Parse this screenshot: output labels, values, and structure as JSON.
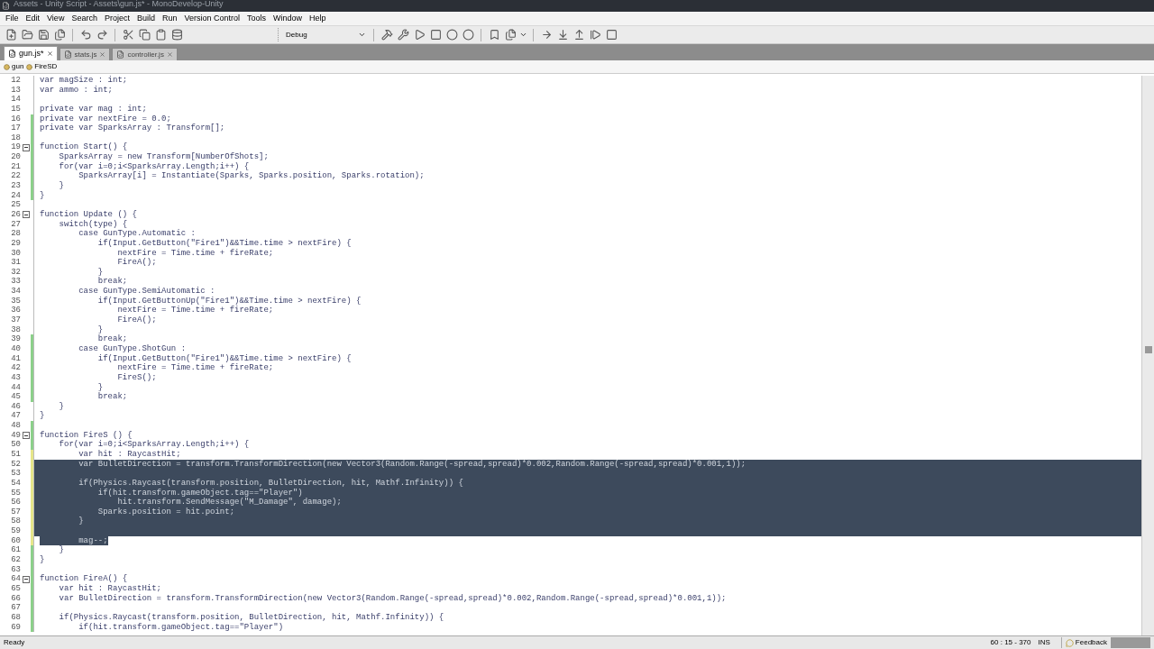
{
  "window": {
    "title": "Assets - Unity Script - Assets\\gun.js* - MonoDevelop-Unity"
  },
  "menu": [
    "File",
    "Edit",
    "View",
    "Search",
    "Project",
    "Build",
    "Run",
    "Version Control",
    "Tools",
    "Window",
    "Help"
  ],
  "toolbar": {
    "configuration": "Debug"
  },
  "tabs": [
    {
      "label": "gun.js*",
      "selected": true
    },
    {
      "label": "stats.js",
      "selected": false
    },
    {
      "label": "controller.js",
      "selected": false
    }
  ],
  "breadcrumb": [
    "gun",
    "FireSD"
  ],
  "lines": [
    {
      "number": "12",
      "text": "var magSize : int;",
      "selected": false
    },
    {
      "number": "13",
      "text": "var ammo : int;",
      "selected": false
    },
    {
      "number": "14",
      "selected": false
    },
    {
      "number": "15",
      "text": "private var mag : int;",
      "selected": false
    },
    {
      "number": "16",
      "text": "private var nextFire = 0.0;",
      "selected": false,
      "color": "#8cd08a"
    },
    {
      "number": "17",
      "text": "private var SparksArray : Transform[];",
      "selected": false,
      "color": "#8cd08a"
    },
    {
      "number": "18",
      "selected": false,
      "color": "#8cd08a"
    },
    {
      "number": "19",
      "text": "function Start() {",
      "selected": false,
      "color": "#8cd08a",
      "fold": true
    },
    {
      "number": "20",
      "text": "    SparksArray = new Transform[NumberOfShots];",
      "selected": false,
      "color": "#8cd08a"
    },
    {
      "number": "21",
      "text": "    for(var i=0;i<SparksArray.Length;i++) {",
      "selected": false,
      "color": "#8cd08a"
    },
    {
      "number": "22",
      "text": "        SparksArray[i] = Instantiate(Sparks, Sparks.position, Sparks.rotation);",
      "selected": false,
      "color": "#8cd08a"
    },
    {
      "number": "23",
      "text": "    }",
      "selected": false,
      "color": "#8cd08a"
    },
    {
      "number": "24",
      "text": "}",
      "selected": false,
      "color": "#8cd08a"
    },
    {
      "number": "25",
      "selected": false
    },
    {
      "number": "26",
      "text": "function Update () {",
      "selected": false,
      "fold": true
    },
    {
      "number": "27",
      "text": "    switch(type) {",
      "selected": false
    },
    {
      "number": "28",
      "text": "        case GunType.Automatic :",
      "selected": false
    },
    {
      "number": "29",
      "text": "            if(Input.GetButton(\"Fire1\")&&Time.time > nextFire) {",
      "selected": false
    },
    {
      "number": "30",
      "text": "                nextFire = Time.time + fireRate;",
      "selected": false
    },
    {
      "number": "31",
      "text": "                FireA();",
      "selected": false
    },
    {
      "number": "32",
      "text": "            }",
      "selected": false
    },
    {
      "number": "33",
      "text": "            break;",
      "selected": false
    },
    {
      "number": "34",
      "text": "        case GunType.SemiAutomatic :",
      "selected": false
    },
    {
      "number": "35",
      "text": "            if(Input.GetButtonUp(\"Fire1\")&&Time.time > nextFire) {",
      "selected": false
    },
    {
      "number": "36",
      "text": "                nextFire = Time.time + fireRate;",
      "selected": false
    },
    {
      "number": "37",
      "text": "                FireA();",
      "selected": false
    },
    {
      "number": "38",
      "text": "            }",
      "selected": false
    },
    {
      "number": "39",
      "text": "            break;",
      "selected": false,
      "color": "#8cd08a"
    },
    {
      "number": "40",
      "text": "        case GunType.ShotGun :",
      "selected": false,
      "color": "#8cd08a"
    },
    {
      "number": "41",
      "text": "            if(Input.GetButton(\"Fire1\")&&Time.time > nextFire) {",
      "selected": false,
      "color": "#8cd08a"
    },
    {
      "number": "42",
      "text": "                nextFire = Time.time + fireRate;",
      "selected": false,
      "color": "#8cd08a"
    },
    {
      "number": "43",
      "text": "                FireS();",
      "selected": false,
      "color": "#8cd08a"
    },
    {
      "number": "44",
      "text": "            }",
      "selected": false,
      "color": "#8cd08a"
    },
    {
      "number": "45",
      "text": "            break;",
      "selected": false,
      "color": "#8cd08a"
    },
    {
      "number": "46",
      "text": "    }",
      "selected": false
    },
    {
      "number": "47",
      "text": "}",
      "selected": false
    },
    {
      "number": "48",
      "selected": false,
      "color": "#8cd08a"
    },
    {
      "number": "49",
      "text": "function FireS () {",
      "selected": false,
      "color": "#8cd08a",
      "fold": true
    },
    {
      "number": "50",
      "text": "    for(var i=0;i<SparksArray.Length;i++) {",
      "selected": false,
      "color": "#8cd08a"
    },
    {
      "number": "51",
      "text": "        var hit : RaycastHit;",
      "selected": false,
      "color": "#e6e68a"
    },
    {
      "number": "52",
      "text": "        var BulletDirection = transform.TransformDirection(new Vector3(Random.Range(-spread,spread)*0.002,Random.Range(-spread,spread)*0.001,1));",
      "selected": true,
      "color": "#e6e68a"
    },
    {
      "number": "53",
      "selected": true,
      "color": "#e6e68a"
    },
    {
      "number": "54",
      "text": "        if(Physics.Raycast(transform.position, BulletDirection, hit, Mathf.Infinity)) {",
      "selected": true,
      "color": "#e6e68a"
    },
    {
      "number": "55",
      "text": "            if(hit.transform.gameObject.tag==\"Player\")",
      "selected": true,
      "color": "#e6e68a"
    },
    {
      "number": "56",
      "text": "                hit.transform.SendMessage(\"M_Damage\", damage);",
      "selected": true,
      "color": "#e6e68a"
    },
    {
      "number": "57",
      "text": "            Sparks.position = hit.point;",
      "selected": true,
      "color": "#e6e68a"
    },
    {
      "number": "58",
      "text": "        }",
      "selected": true,
      "color": "#e6e68a"
    },
    {
      "number": "59",
      "selected": true,
      "color": "#e6e68a"
    },
    {
      "number": "60",
      "text": "        mag--;",
      "selected": true,
      "color": "#e6e68a",
      "selection_ends": true
    },
    {
      "number": "61",
      "text": "    }",
      "selected": false,
      "color": "#8cd08a"
    },
    {
      "number": "62",
      "text": "}",
      "selected": false,
      "color": "#8cd08a"
    },
    {
      "number": "63",
      "selected": false,
      "color": "#8cd08a"
    },
    {
      "number": "64",
      "text": "function FireA() {",
      "selected": false,
      "color": "#8cd08a",
      "fold": true
    },
    {
      "number": "65",
      "text": "    var hit : RaycastHit;",
      "selected": false,
      "color": "#8cd08a"
    },
    {
      "number": "66",
      "text": "    var BulletDirection = transform.TransformDirection(new Vector3(Random.Range(-spread,spread)*0.002,Random.Range(-spread,spread)*0.001,1));",
      "selected": false,
      "color": "#8cd08a"
    },
    {
      "number": "67",
      "selected": false,
      "color": "#8cd08a"
    },
    {
      "number": "68",
      "text": "    if(Physics.Raycast(transform.position, BulletDirection, hit, Mathf.Infinity)) {",
      "selected": false,
      "color": "#8cd08a"
    },
    {
      "number": "69",
      "text": "        if(hit.transform.gameObject.tag==\"Player\")",
      "selected": false,
      "color": "#8cd08a"
    }
  ],
  "status_bar": {
    "message": "Ready",
    "position": "60 : 15 - 370",
    "mode": "INS",
    "feedback": "Feedback"
  }
}
